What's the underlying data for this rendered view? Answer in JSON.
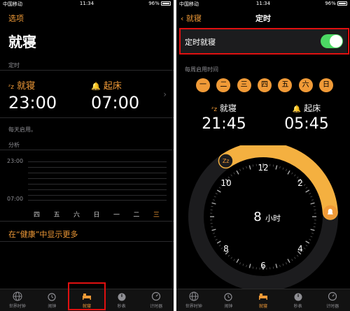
{
  "status": {
    "carrier": "中国移动",
    "time": "11:34",
    "battery": "96%"
  },
  "left": {
    "nav_label": "选项",
    "title": "就寝",
    "schedule_label": "定时",
    "bedtime": {
      "label": "就寝",
      "time": "23:00",
      "icon": "zz-icon"
    },
    "wake": {
      "label": "起床",
      "time": "07:00",
      "icon": "bell-icon"
    },
    "every_day": "每天启用。",
    "analysis_label": "分析",
    "chart": {
      "top_label": "23:00",
      "bottom_label": "07:00"
    },
    "days": [
      "四",
      "五",
      "六",
      "日",
      "一",
      "二",
      "三"
    ],
    "health_link": "在“健康”中显示更多"
  },
  "right": {
    "back_label": "就寝",
    "nav_title": "定时",
    "toggle_label": "定时就寝",
    "toggle_on": true,
    "weekly_label": "每周启用时间",
    "weekdays": [
      "一",
      "二",
      "三",
      "四",
      "五",
      "六",
      "日"
    ],
    "bedtime": {
      "label": "就寝",
      "time": "21:45"
    },
    "wake": {
      "label": "起床",
      "time": "05:45"
    },
    "duration": {
      "hours": "8",
      "unit": "小时"
    },
    "dial_numbers": [
      "12",
      "2",
      "4",
      "6",
      "8",
      "10"
    ]
  },
  "tabs": [
    {
      "label": "世界时钟",
      "icon": "globe-icon"
    },
    {
      "label": "闹钟",
      "icon": "alarm-icon"
    },
    {
      "label": "就寝",
      "icon": "bed-icon"
    },
    {
      "label": "秒表",
      "icon": "stopwatch-icon"
    },
    {
      "label": "计时器",
      "icon": "timer-icon"
    }
  ],
  "colors": {
    "accent": "#f09a37",
    "toggle": "#4cd964",
    "highlight": "#e01010"
  }
}
